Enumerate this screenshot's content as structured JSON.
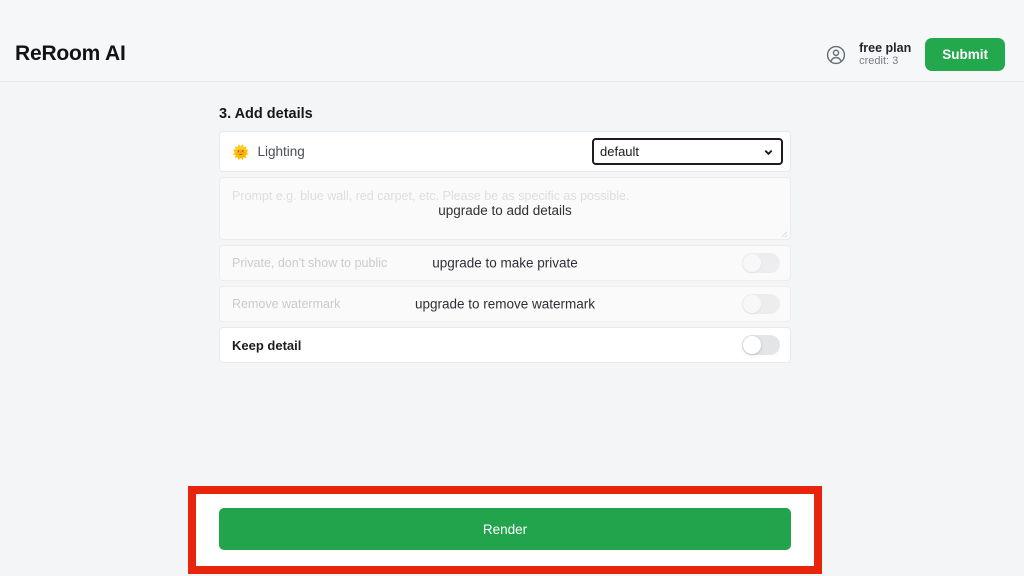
{
  "header": {
    "brand": "ReRoom AI",
    "avatar_icon": "user-circle-icon",
    "plan_name": "free plan",
    "plan_credit": "credit: 3",
    "submit_label": "Submit"
  },
  "main": {
    "section_title": "3. Add details",
    "lighting": {
      "icon": "sun-icon",
      "label": "Lighting",
      "selected": "default",
      "options": [
        "default"
      ],
      "chevron_icon": "chevron-down-icon"
    },
    "prompt": {
      "placeholder": "Prompt e.g. blue wall, red carpet, etc. Please be as specific as possible.",
      "value": "",
      "overlay": "upgrade to add details",
      "resize_icon": "resize-handle-icon"
    },
    "toggles": [
      {
        "label": "Private, don't show to public",
        "overlay": "upgrade to make private",
        "state": "off",
        "disabled": true
      },
      {
        "label": "Remove watermark",
        "overlay": "upgrade to remove watermark",
        "state": "off",
        "disabled": true
      },
      {
        "label": "Keep detail",
        "overlay": "",
        "state": "off",
        "disabled": false
      }
    ],
    "render_label": "Render"
  },
  "colors": {
    "brand_green": "#22a44d",
    "submit_green": "#24a84d",
    "highlight_red": "#e8250c",
    "page_background": "#f4f5f6"
  }
}
